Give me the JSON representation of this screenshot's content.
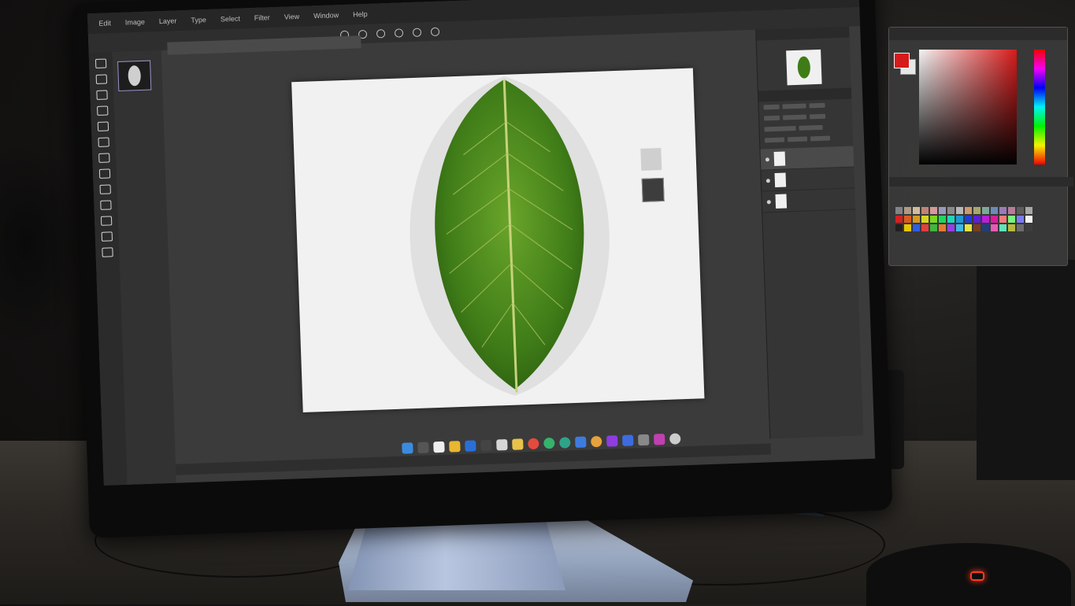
{
  "scene": {
    "description_icons": [
      "monitor-icon",
      "leaf-icon"
    ],
    "accent_colors": {
      "leaf": "#4c8a1e",
      "fg_color": "#e01b1b",
      "led": "#ff3b1f"
    }
  },
  "app": {
    "menu": [
      "Edit",
      "Image",
      "Layer",
      "Type",
      "Select",
      "Filter",
      "View",
      "Window",
      "Help"
    ],
    "doc_tab": "",
    "left_panel_label": "",
    "right_panel": {
      "navigator_title": "",
      "properties_title": "",
      "layers": [
        {
          "name": "",
          "selected": true
        },
        {
          "name": "",
          "selected": false
        },
        {
          "name": "",
          "selected": false
        }
      ]
    },
    "status": ""
  },
  "color_panel": {
    "title": "",
    "swatches_title": "",
    "footer": ""
  }
}
